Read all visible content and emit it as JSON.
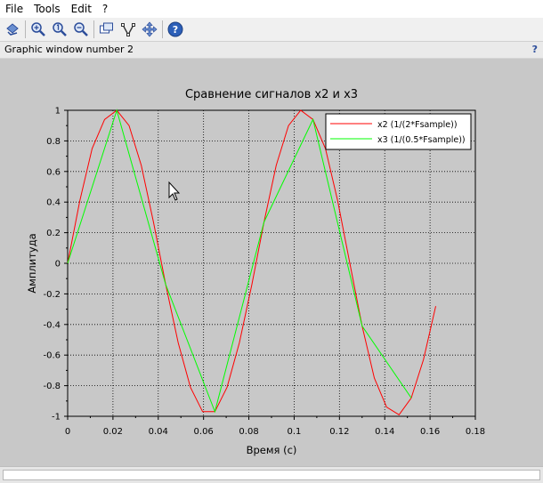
{
  "menubar": {
    "items": [
      "File",
      "Tools",
      "Edit",
      "?"
    ]
  },
  "toolbar": {
    "tools": [
      "2d-3d-rotate-icon",
      "zoom-in-icon",
      "zoom-original-icon",
      "zoom-area-icon",
      "data-tip-icon",
      "data-points-icon",
      "pan-icon",
      "help-icon"
    ]
  },
  "window": {
    "title": "Graphic window number 2",
    "help_mark": "?"
  },
  "chart_data": {
    "type": "line",
    "title": "Сравнение сигналов x2 и x3",
    "xlabel": "Время (с)",
    "ylabel": "Амплитуда",
    "xlim": [
      0,
      0.18
    ],
    "ylim": [
      -1,
      1
    ],
    "grid": true,
    "legend_position": "top-right",
    "x_ticks": [
      "0",
      "0.02",
      "0.04",
      "0.06",
      "0.08",
      "0.1",
      "0.12",
      "0.14",
      "0.16",
      "0.18"
    ],
    "y_ticks": [
      "-1",
      "-0.8",
      "-0.6",
      "-0.4",
      "-0.2",
      "0",
      "0.2",
      "0.4",
      "0.6",
      "0.8",
      "1"
    ],
    "series": [
      {
        "name": "x2 (1/(2*Fsample))",
        "color": "#ff0000",
        "x": [
          0,
          0.0054,
          0.0108,
          0.0163,
          0.0217,
          0.0271,
          0.0325,
          0.0379,
          0.0433,
          0.0488,
          0.0542,
          0.0596,
          0.065,
          0.0704,
          0.0758,
          0.0813,
          0.0867,
          0.0921,
          0.0975,
          0.1029,
          0.1083,
          0.1138,
          0.1192,
          0.1246,
          0.13,
          0.1354,
          0.1408,
          0.1463,
          0.1517,
          0.1571,
          0.1625
        ],
        "y": [
          0,
          0.41,
          0.75,
          0.94,
          1.0,
          0.9,
          0.64,
          0.27,
          -0.14,
          -0.52,
          -0.81,
          -0.97,
          -0.97,
          -0.81,
          -0.52,
          -0.14,
          0.27,
          0.64,
          0.9,
          1.0,
          0.94,
          0.75,
          0.41,
          0.0,
          -0.41,
          -0.75,
          -0.94,
          -0.99,
          -0.88,
          -0.63,
          -0.28
        ]
      },
      {
        "name": "x3 (1/(0.5*Fsample))",
        "color": "#00ff00",
        "x": [
          0,
          0.0217,
          0.0433,
          0.065,
          0.0867,
          0.1083,
          0.13,
          0.1517
        ],
        "y": [
          0,
          1.0,
          -0.14,
          -0.97,
          0.27,
          0.94,
          -0.41,
          -0.88
        ]
      }
    ]
  }
}
